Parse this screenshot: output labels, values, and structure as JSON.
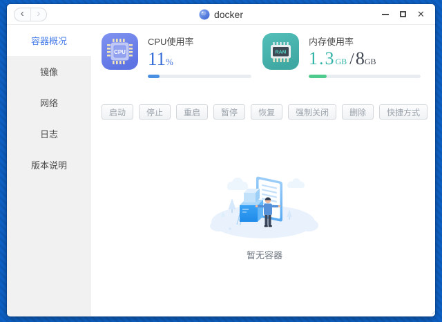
{
  "titlebar": {
    "title": "docker",
    "app_icon": "docker-ball-icon",
    "back_glyph": "‹",
    "forward_glyph": "›",
    "close_glyph": "✕"
  },
  "sidebar": {
    "items": [
      {
        "label": "容器概况",
        "active": true
      },
      {
        "label": "镜像",
        "active": false
      },
      {
        "label": "网络",
        "active": false
      },
      {
        "label": "日志",
        "active": false
      },
      {
        "label": "版本说明",
        "active": false
      }
    ]
  },
  "stats": {
    "cpu": {
      "icon": "cpu-chip-icon",
      "icon_label": "CPU",
      "label": "CPU使用率",
      "value": "11",
      "unit": "%",
      "percent": 11
    },
    "memory": {
      "icon": "ram-chip-icon",
      "icon_label": "RAM",
      "label": "内存使用率",
      "used": "1.3",
      "used_unit": "GB",
      "divider": "/",
      "total": "8",
      "total_unit": "GB",
      "percent": 16
    }
  },
  "toolbar": {
    "buttons": [
      "启动",
      "停止",
      "重启",
      "暂停",
      "恢复",
      "强制关闭",
      "删除",
      "快捷方式"
    ]
  },
  "empty_state": {
    "message": "暂无容器",
    "illustration": "no-containers-illustration"
  },
  "colors": {
    "desktop": "#0e62c7",
    "sidebar_active_text": "#4a7fe8",
    "cpu_accent": "#3a6fd8",
    "cpu_bar": "#4a90e2",
    "memory_accent": "#2fb3a6",
    "memory_bar": "#4ecb8d",
    "cpu_icon_bg": "#6b80e9",
    "ram_icon_bg": "#49b4ae"
  }
}
